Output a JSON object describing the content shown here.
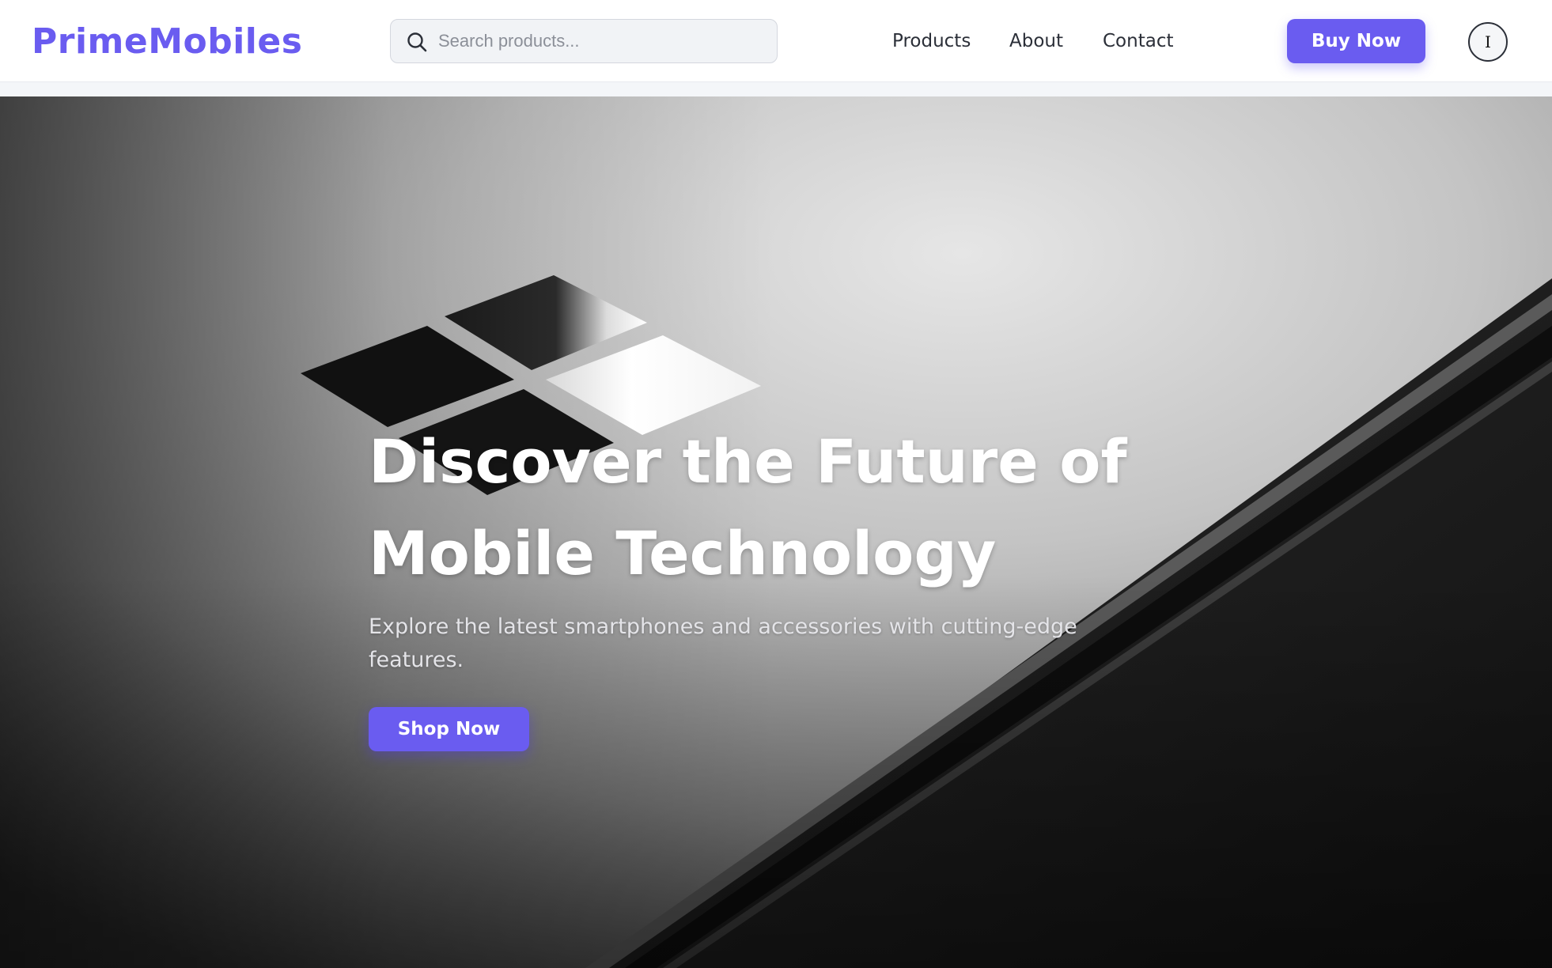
{
  "header": {
    "brand": "PrimeMobiles",
    "search": {
      "placeholder": "Search products..."
    },
    "nav": {
      "products": "Products",
      "about": "About",
      "contact": "Contact"
    },
    "cta_label": "Buy Now",
    "user_initial": "I"
  },
  "hero": {
    "title": "Discover the Future of Mobile Technology",
    "subtitle": "Explore the latest smartphones and accessories with cutting-edge features.",
    "cta_label": "Shop Now",
    "background_image": "grayscale close-up of a laptop lid with a four-pane window logo"
  },
  "icons": {
    "search": "search-icon",
    "user": "user-avatar-icon"
  },
  "colors": {
    "brand": "#6a5cf0",
    "nav_text": "#2b2f38",
    "search_bg": "#f1f3f6",
    "hero_text": "#ffffff"
  }
}
